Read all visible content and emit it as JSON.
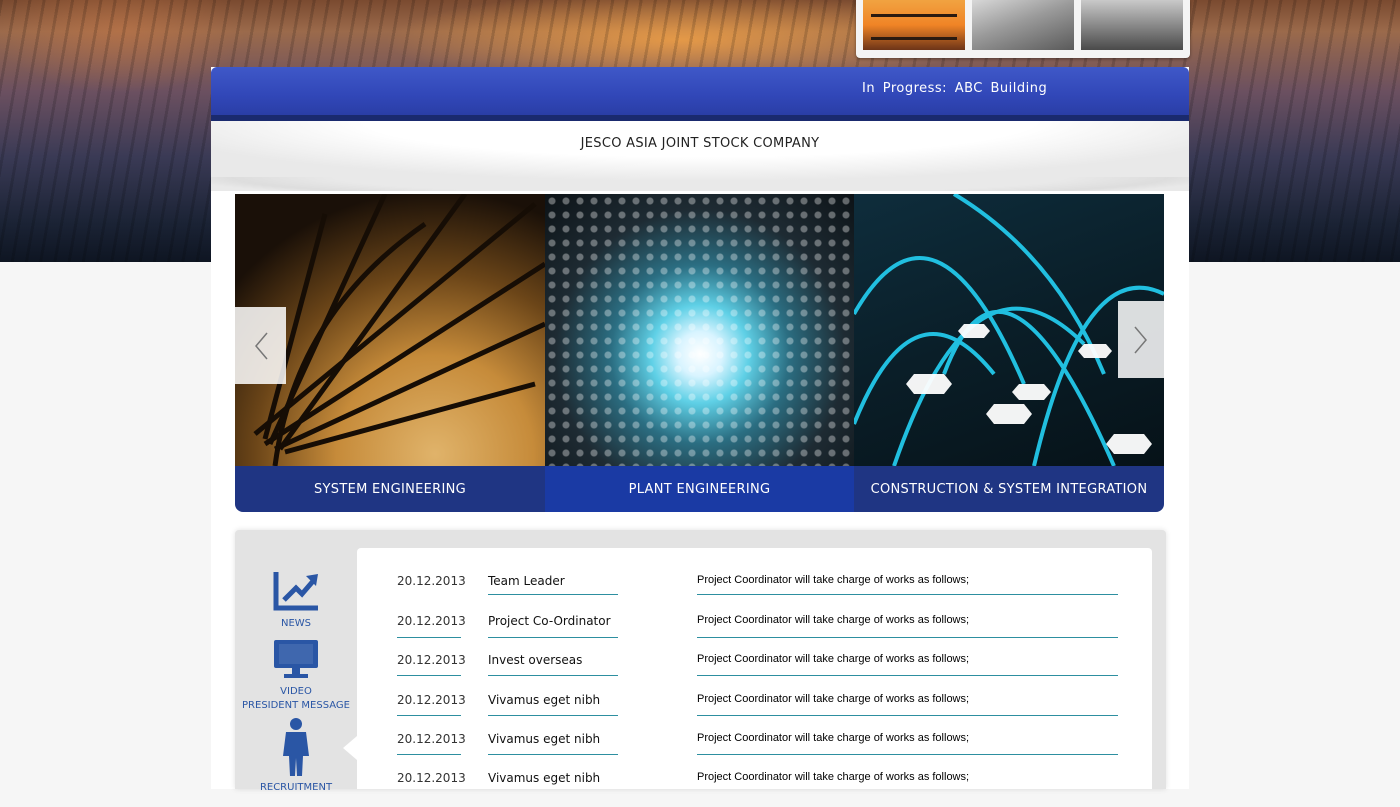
{
  "header": {
    "progress_text": "In Progress: ABC Building",
    "company_name": "JESCO ASIA JOINT STOCK COMPANY"
  },
  "thumbnails": [
    "bridge-photo",
    "architecture-photo",
    "people-photo"
  ],
  "slider": {
    "panels": [
      {
        "caption": "SYSTEM ENGINEERING"
      },
      {
        "caption": "PLANT ENGINEERING"
      },
      {
        "caption": "CONSTRUCTION & SYSTEM INTEGRATION"
      }
    ],
    "prev_icon": "chevron-left-icon",
    "next_icon": "chevron-right-icon"
  },
  "sidebar": {
    "items": [
      {
        "label": "NEWS",
        "icon": "chart-icon"
      },
      {
        "label": "VIDEO",
        "icon": "monitor-icon"
      },
      {
        "label": "PRESIDENT MESSAGE",
        "icon": "person-icon"
      },
      {
        "label": "RECRUITMENT",
        "icon": ""
      }
    ]
  },
  "list": {
    "rows": [
      {
        "date": "20.12.2013",
        "title": "Team Leader",
        "description": "Project Coordinator will take charge of works as follows;"
      },
      {
        "date": "20.12.2013",
        "title": "Project Co-Ordinator",
        "description": "Project Coordinator will take charge of works as follows;"
      },
      {
        "date": "20.12.2013",
        "title": "Invest overseas",
        "description": "Project Coordinator will take charge of works as follows;"
      },
      {
        "date": "20.12.2013",
        "title": "Vivamus eget nibh",
        "description": "Project Coordinator will take charge of works as follows;"
      },
      {
        "date": "20.12.2013",
        "title": "Vivamus eget nibh",
        "description": "Project Coordinator will take charge of works as follows;"
      },
      {
        "date": "20.12.2013",
        "title": "Vivamus eget nibh",
        "description": "Project Coordinator will take charge of works as follows;"
      }
    ]
  },
  "colors": {
    "brand_blue": "#3147b8",
    "caption_blue": "#1f3583",
    "icon_blue": "#2a56a5",
    "divider_teal": "#2d8fa0"
  }
}
